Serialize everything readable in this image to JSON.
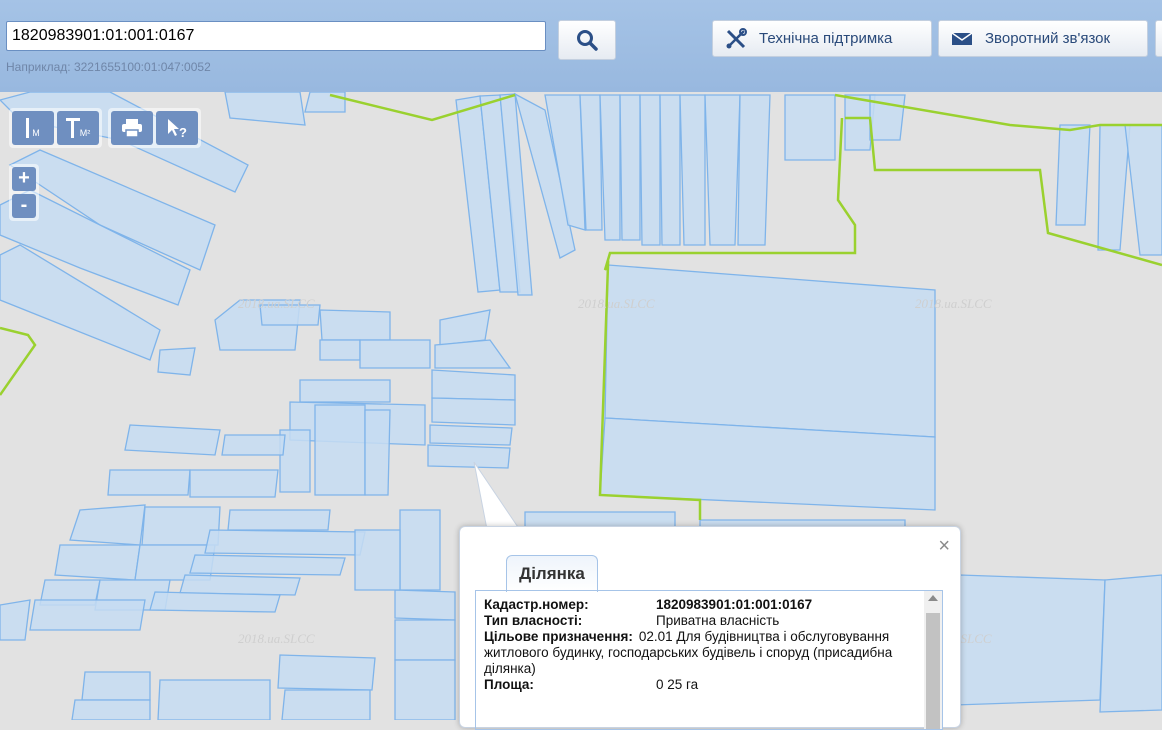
{
  "search": {
    "value": "1820983901:01:001:0167",
    "hint": "Наприклад: 3221655100:01:047:0052"
  },
  "header": {
    "support_label": "Технічна підтримка",
    "feedback_label": "Зворотний зв'язок"
  },
  "map": {
    "tool_ruler_label": "М",
    "tool_area_label": "М²",
    "zoom_in": "+",
    "zoom_out": "-",
    "watermark": "2018.ua.SLCC"
  },
  "popup": {
    "tab_label": "Ділянка",
    "close": "×",
    "cadastral_label": "Кадастр.номер:",
    "cadastral_value": "1820983901:01:001:0167",
    "ownership_label": "Тип власності:",
    "ownership_value": "Приватна власність",
    "purpose_label": "Цільове призначення:",
    "purpose_value_first": "02.01 Для будівництва і",
    "purpose_value_rest": "обслуговування житлового будинку, господарських будівель і споруд (присадибна ділянка)",
    "area_label": "Площа:",
    "area_value": "0 25 га"
  },
  "colors": {
    "parcel_fill": "#c5dcf2",
    "parcel_stroke": "#7fb4ea",
    "boundary": "#9ad12f",
    "map_bg": "#e2e2e2",
    "tool_button": "#6f8fc0"
  }
}
